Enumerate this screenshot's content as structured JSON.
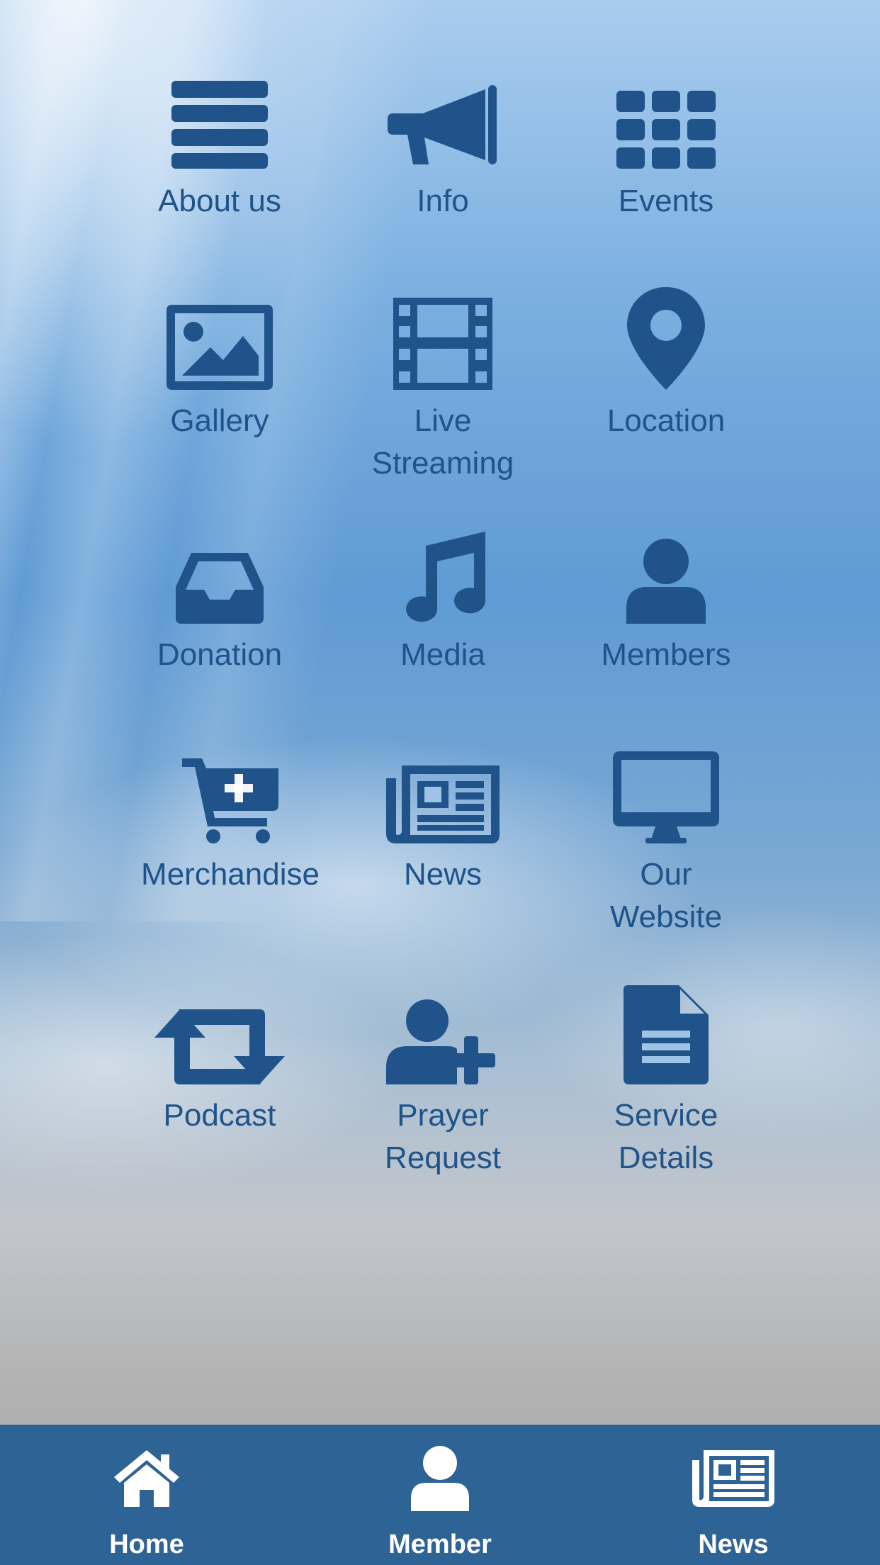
{
  "colors": {
    "icon_blue": "#1f5389",
    "tabbar_bg": "#2e6396",
    "tab_text": "#ffffff"
  },
  "menu": [
    {
      "label": "About us",
      "icon": "list-icon"
    },
    {
      "label": "Info",
      "icon": "megaphone-icon"
    },
    {
      "label": "Events",
      "icon": "grid-icon"
    },
    {
      "label": "Gallery",
      "icon": "picture-icon"
    },
    {
      "label": "Live Streaming",
      "icon": "film-icon"
    },
    {
      "label": "Location",
      "icon": "map-pin-icon"
    },
    {
      "label": "Donation",
      "icon": "inbox-icon"
    },
    {
      "label": "Media",
      "icon": "music-icon"
    },
    {
      "label": "Members",
      "icon": "user-icon"
    },
    {
      "label": "Merchandise",
      "icon": "cart-plus-icon"
    },
    {
      "label": "News",
      "icon": "newspaper-icon"
    },
    {
      "label": "Our Website",
      "icon": "monitor-icon"
    },
    {
      "label": "Podcast",
      "icon": "retweet-icon"
    },
    {
      "label": "Prayer Request",
      "icon": "user-plus-icon"
    },
    {
      "label": "Service Details",
      "icon": "document-icon"
    }
  ],
  "tabs": [
    {
      "label": "Home",
      "icon": "home-icon"
    },
    {
      "label": "Member",
      "icon": "user-icon"
    },
    {
      "label": "News",
      "icon": "newspaper-icon"
    }
  ]
}
